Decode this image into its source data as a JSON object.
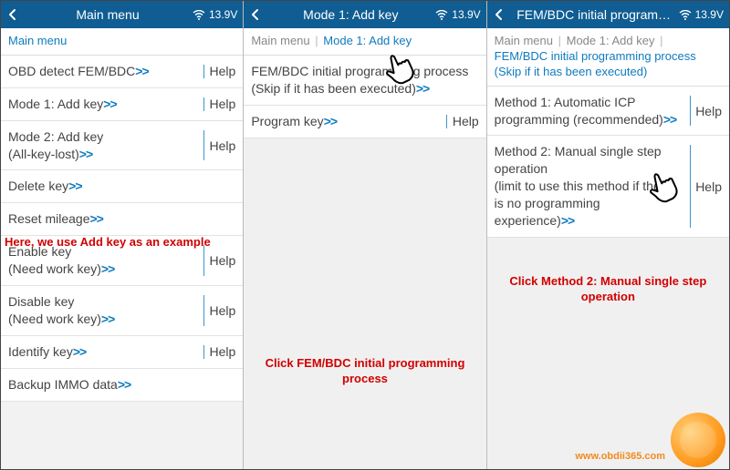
{
  "status": {
    "voltage": "13.9V"
  },
  "common": {
    "help_label": "Help",
    "arrows": ">>"
  },
  "panel1": {
    "title": "Main menu",
    "breadcrumb": [
      {
        "label": "Main menu",
        "active": true
      }
    ],
    "items": [
      {
        "text": "OBD detect FEM/BDC",
        "help": true
      },
      {
        "text": "Mode 1: Add key",
        "help": true
      },
      {
        "text": "Mode 2: Add key\n(All-key-lost)",
        "help": true
      },
      {
        "text": "Delete key",
        "help": false
      },
      {
        "text": "Reset mileage",
        "help": false
      },
      {
        "text": "Enable key\n(Need work key)",
        "help": true
      },
      {
        "text": "Disable key\n(Need work key)",
        "help": true
      },
      {
        "text": "Identify key",
        "help": true
      },
      {
        "text": "Backup IMMO data",
        "help": false
      }
    ],
    "annotation": "Here, we use Add key as an example"
  },
  "panel2": {
    "title": "Mode 1: Add key",
    "breadcrumb": [
      {
        "label": "Main menu",
        "active": false
      },
      {
        "label": "Mode 1: Add key",
        "active": true
      }
    ],
    "items": [
      {
        "text": "FEM/BDC initial programming process\n(Skip if it has been executed)",
        "help": false
      },
      {
        "text": "Program key",
        "help": true
      }
    ],
    "annotation": "Click FEM/BDC initial programming process"
  },
  "panel3": {
    "title": "FEM/BDC initial program…",
    "breadcrumb_prefix": [
      {
        "label": "Main menu"
      },
      {
        "label": "Mode 1: Add key"
      }
    ],
    "breadcrumb_active": "FEM/BDC initial programming process (Skip if it has been executed)",
    "items": [
      {
        "text": "Method 1: Automatic ICP programming (recommended)",
        "help": true
      },
      {
        "text": "Method 2: Manual single step operation\n(limit to use this method if there is no programming experience)",
        "help": true
      }
    ],
    "annotation": "Click Method 2: Manual single step operation"
  },
  "watermark": "www.obdii365.com"
}
